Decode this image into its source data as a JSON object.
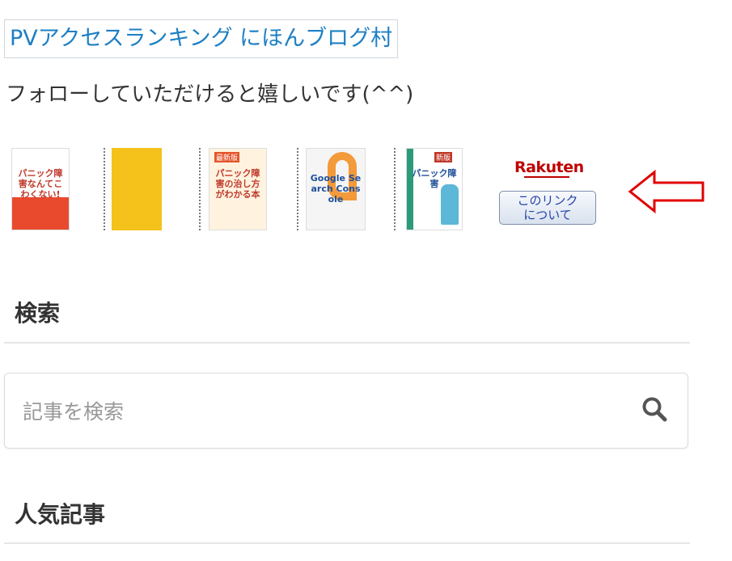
{
  "ranking_link": {
    "label": "PVアクセスランキング にほんブログ村"
  },
  "follow_text": "フォローしていただけると嬉しいです(^^)",
  "books": [
    {
      "title": "パニック障害なんてこわくない!"
    },
    {
      "title": ""
    },
    {
      "title": "パニック障害の治し方がわかる本",
      "badge": "最新版"
    },
    {
      "title": "Google Search Console"
    },
    {
      "title": "パニック障害",
      "badge": "新版"
    }
  ],
  "rakuten": {
    "logo": "Rakuten",
    "link_about": "このリンク\nについて"
  },
  "sections": {
    "search_title": "検索",
    "popular_title": "人気記事"
  },
  "search": {
    "placeholder": "記事を検索"
  },
  "colors": {
    "link": "#1d7fc4",
    "arrow": "#e10000",
    "rakuten": "#bf0000"
  }
}
